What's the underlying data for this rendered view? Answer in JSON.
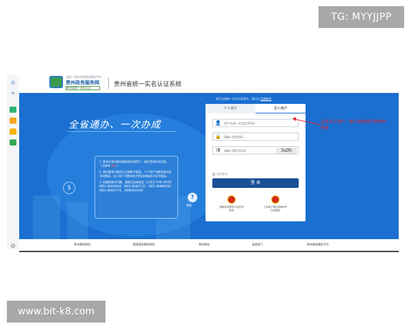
{
  "watermarks": {
    "tg": "TG: MYYJJPP",
    "site": "www.bit-k8.com"
  },
  "header": {
    "logo_tag": "全国一体化在线政务服务平台",
    "logo_title": "贵州政务服务网",
    "logo_sub": "贵州省统一身份认证",
    "system_title": "贵州省统一实名认证系统"
  },
  "hero": {
    "slogan": "全省通办、一次办成",
    "notice": [
      "1. 首次在贵州政务服务网注册用户，请先完成实名注册。（可参考",
      "2. 首次登录可使用已注册账号登录，个人用户可使用身份证号码登录，法人用户可使用电子营业执照或CA证书登录。",
      "3. 如遇到账号问题，请拨打咨询电话（工作日 9:00-18:00）0851-86866600、0851-86867125、0851-86866830、0851-86687176、18985024339"
    ],
    "notice_link": "操作",
    "help_label": "帮助"
  },
  "login": {
    "topline_note": "如已注册统一实名认证账号，请点击",
    "topline_link": "注册账号",
    "tabs": {
      "personal": "个人用户",
      "legal": "法人用户"
    },
    "fields": {
      "username_placeholder": "用户名/统一社会信用代码",
      "password_placeholder": "请输入您的密码",
      "captcha_placeholder": "请输入图形验证码",
      "captcha_text": "3uDh"
    },
    "remember_label": "记住账号",
    "login_button": "登 录",
    "emblems": [
      {
        "label": "国家政务服务平台在线登录"
      },
      {
        "label": "工商电子营业执照APP扫码登录"
      }
    ]
  },
  "annotation": "点击法人用户，输入相关账号密码并登录",
  "footer": {
    "links": [
      "贵州政府网站",
      "国家政务服务网站",
      "贵州网站",
      "省直部门",
      "贵州政务服务平台"
    ]
  },
  "colors": {
    "hero_blue": "#1a6fd0",
    "login_button": "#1b4f96",
    "annotation_red": "#e4202d"
  }
}
